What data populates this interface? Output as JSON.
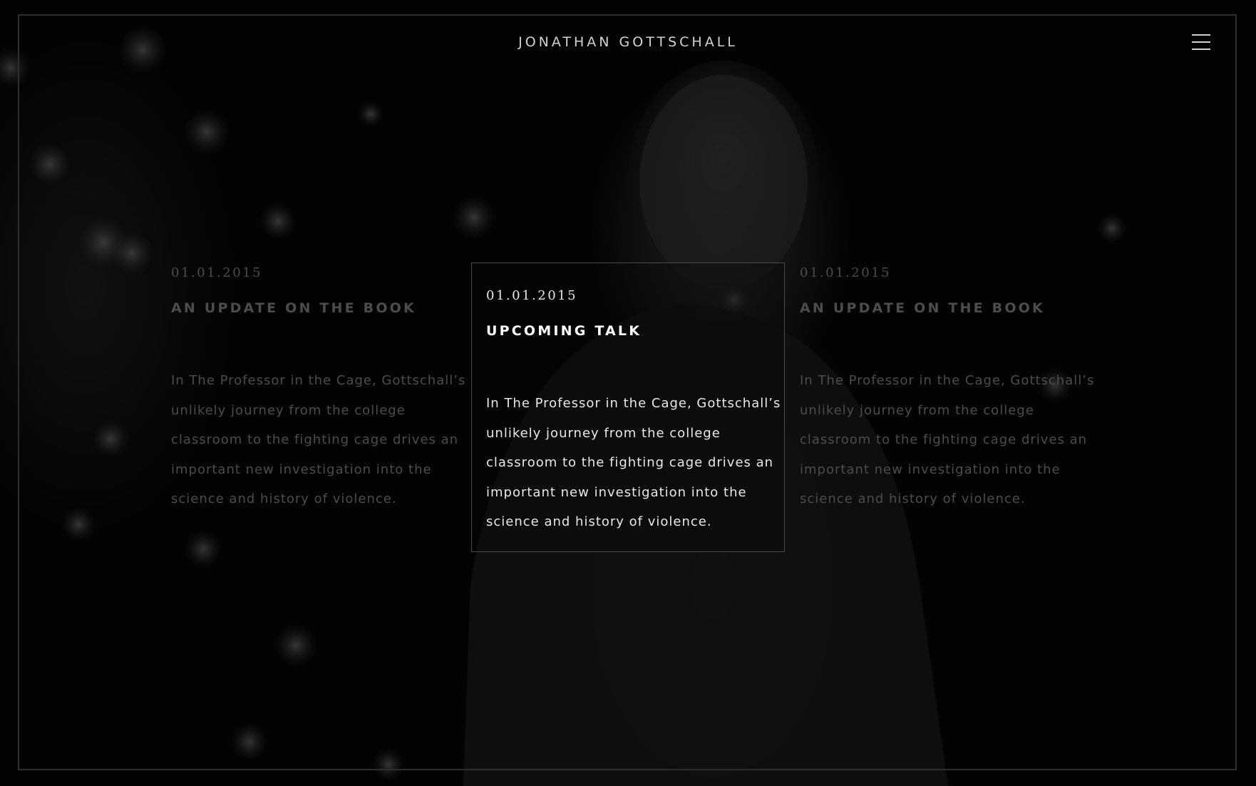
{
  "site": {
    "title": "JONATHAN GOTTSCHALL",
    "menu_icon": "hamburger-menu-icon"
  },
  "posts": [
    {
      "date": "01.01.2015",
      "title": "AN UPDATE ON THE BOOK",
      "body": "In The Professor in the Cage, Gottschall’s unlikely journey from the college classroom to the fighting cage drives an important new investigation into the science and history of violence.",
      "state": "dimmed"
    },
    {
      "date": "01.01.2015",
      "title": "UPCOMING TALK",
      "body": "In The Professor in the Cage, Gottschall’s unlikely journey from the college classroom to the fighting cage drives an important new investigation into the science and history of violence.",
      "state": "active"
    },
    {
      "date": "01.01.2015",
      "title": "AN UPDATE ON THE BOOK",
      "body": "In The Professor in the Cage, Gottschall’s unlikely journey from the college classroom to the fighting cage drives an important new investigation into the science and history of violence.",
      "state": "dimmed"
    }
  ],
  "colors": {
    "background": "#050505",
    "frame_border": "#2e2e2e",
    "active_text": "#ffffff",
    "dimmed_text": "#4c4c4c"
  }
}
